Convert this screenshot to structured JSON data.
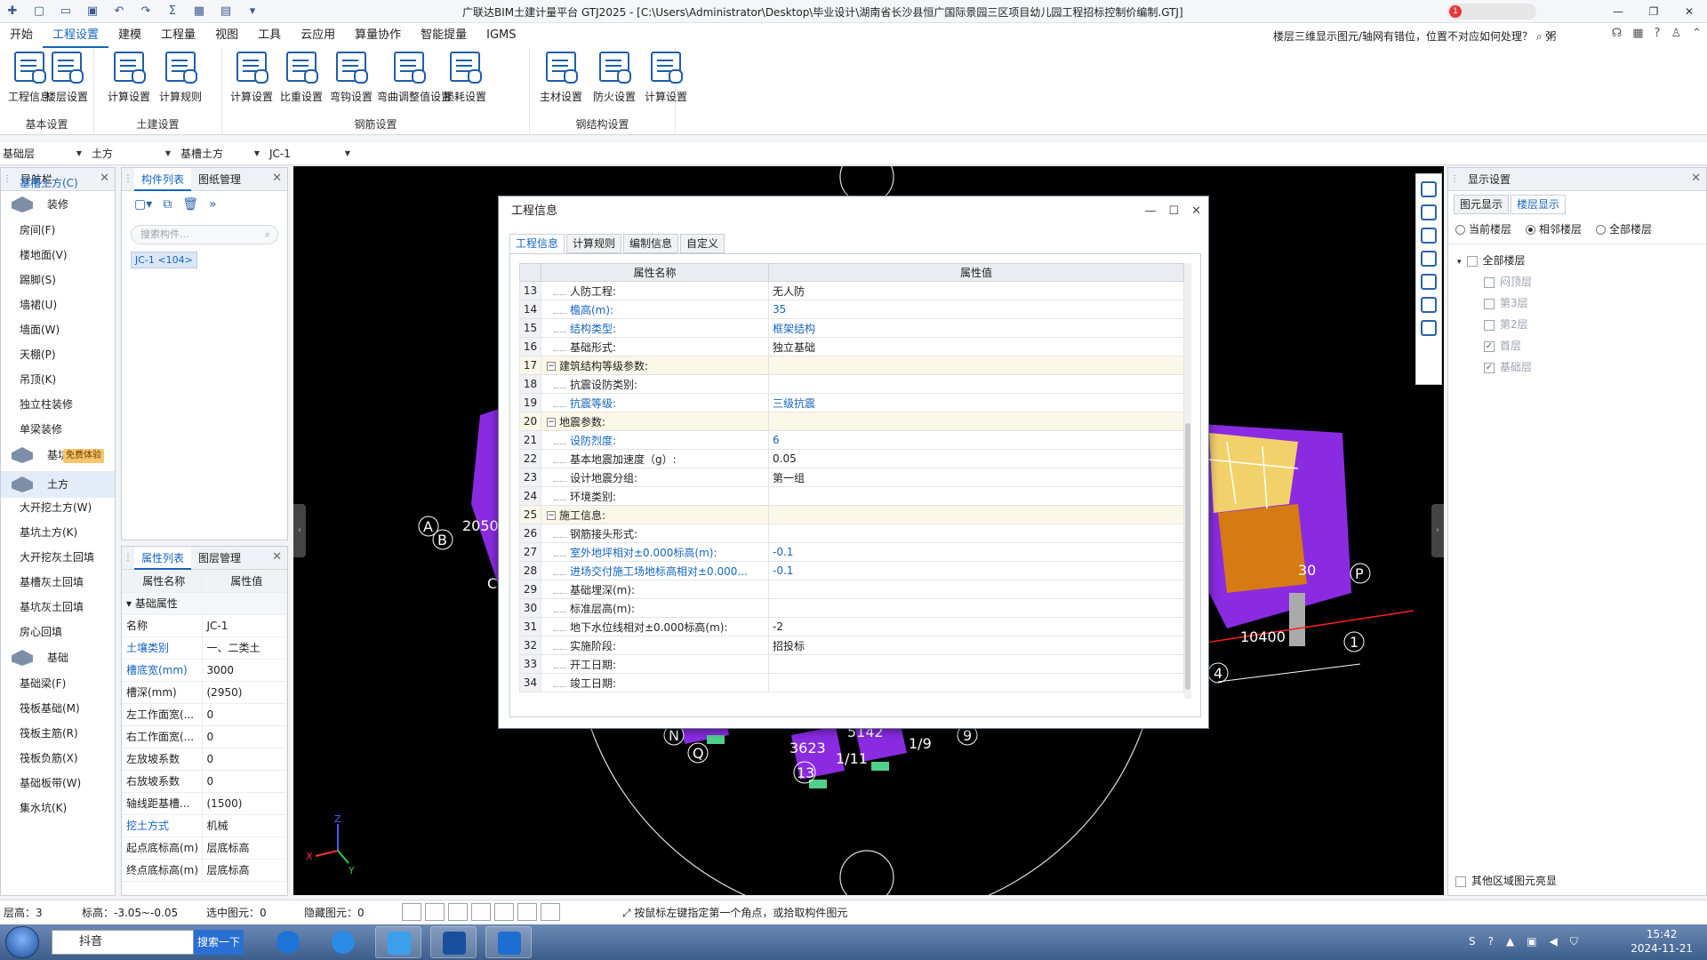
{
  "window": {
    "title": "广联达BIM土建计量平台 GTJ2025 - [C:\\Users\\Administrator\\Desktop\\毕业设计\\湖南省长沙县恒广国际景园三区项目幼儿园工程招标控制价编制.GTJ]",
    "badge_count": "1"
  },
  "menu": {
    "items": [
      "开始",
      "工程设置",
      "建模",
      "工程量",
      "视图",
      "工具",
      "云应用",
      "算量协作",
      "智能提量",
      "IGMS"
    ],
    "active": "工程设置",
    "help_question": "楼层三维显示图元/轴网有错位，位置不对应如何处理？",
    "help_suffix": "粥"
  },
  "ribbon": {
    "groups": [
      {
        "label": "基本设置",
        "buttons": [
          "工程信息",
          "楼层设置"
        ]
      },
      {
        "label": "土建设置",
        "buttons": [
          "计算设置",
          "计算规则"
        ]
      },
      {
        "label": "钢筋设置",
        "buttons": [
          "计算设置",
          "比重设置",
          "弯钩设置",
          "弯曲调整值设置",
          "损耗设置"
        ]
      },
      {
        "label": "钢结构设置",
        "buttons": [
          "主材设置",
          "防火设置",
          "计算设置"
        ]
      }
    ]
  },
  "selectors": {
    "floor": "基础层",
    "category": "土方",
    "type": "基槽土方",
    "component": "JC-1"
  },
  "nav": {
    "title": "导航栏",
    "tree": [
      {
        "kind": "cat",
        "label": "装修",
        "selected": false
      },
      {
        "kind": "item",
        "label": "房间(F)"
      },
      {
        "kind": "item",
        "label": "楼地面(V)"
      },
      {
        "kind": "item",
        "label": "踢脚(S)"
      },
      {
        "kind": "item",
        "label": "墙裙(U)"
      },
      {
        "kind": "item",
        "label": "墙面(W)"
      },
      {
        "kind": "item",
        "label": "天棚(P)"
      },
      {
        "kind": "item",
        "label": "吊顶(K)"
      },
      {
        "kind": "item",
        "label": "独立柱装修"
      },
      {
        "kind": "item",
        "label": "单梁装修"
      },
      {
        "kind": "cat",
        "label": "基坑支护",
        "badge": "免费体验",
        "selected": false
      },
      {
        "kind": "cat",
        "label": "土方",
        "selected": true
      },
      {
        "kind": "item",
        "label": "大开挖土方(W)"
      },
      {
        "kind": "item",
        "label": "基槽土方(C)",
        "selected": true
      },
      {
        "kind": "item",
        "label": "基坑土方(K)"
      },
      {
        "kind": "item",
        "label": "大开挖灰土回填"
      },
      {
        "kind": "item",
        "label": "基槽灰土回填"
      },
      {
        "kind": "item",
        "label": "基坑灰土回填"
      },
      {
        "kind": "item",
        "label": "房心回填"
      },
      {
        "kind": "cat",
        "label": "基础",
        "selected": false
      },
      {
        "kind": "item",
        "label": "基础梁(F)"
      },
      {
        "kind": "item",
        "label": "筏板基础(M)"
      },
      {
        "kind": "item",
        "label": "筏板主筋(R)"
      },
      {
        "kind": "item",
        "label": "筏板负筋(X)"
      },
      {
        "kind": "item",
        "label": "基础板带(W)"
      },
      {
        "kind": "item",
        "label": "集水坑(K)"
      }
    ]
  },
  "component_panel": {
    "tabs": [
      "构件列表",
      "图纸管理"
    ],
    "search_placeholder": "搜索构件...",
    "items": [
      "JC-1 <104>"
    ]
  },
  "property_panel": {
    "tabs": [
      "属性列表",
      "图层管理"
    ],
    "headers": [
      "属性名称",
      "属性值"
    ],
    "group": "基础属性",
    "rows": [
      {
        "name": "名称",
        "value": "JC-1",
        "blue": false
      },
      {
        "name": "土壤类别",
        "value": "一、二类土",
        "blue": true
      },
      {
        "name": "槽底宽(mm)",
        "value": "3000",
        "blue": true
      },
      {
        "name": "槽深(mm)",
        "value": "(2950)",
        "blue": false
      },
      {
        "name": "左工作面宽(...",
        "value": "0",
        "blue": false
      },
      {
        "name": "右工作面宽(...",
        "value": "0",
        "blue": false
      },
      {
        "name": "左放坡系数",
        "value": "0",
        "blue": false
      },
      {
        "name": "右放坡系数",
        "value": "0",
        "blue": false
      },
      {
        "name": "轴线距基槽...",
        "value": "(1500)",
        "blue": false
      },
      {
        "name": "挖土方式",
        "value": "机械",
        "blue": true
      },
      {
        "name": "起点底标高(m)",
        "value": "层底标高",
        "blue": false
      },
      {
        "name": "终点底标高(m)",
        "value": "层底标高",
        "blue": false
      }
    ]
  },
  "dialog": {
    "title": "工程信息",
    "tabs": [
      "工程信息",
      "计算规则",
      "编制信息",
      "自定义"
    ],
    "active_tab": "工程信息",
    "headers": [
      "属性名称",
      "属性值"
    ],
    "rows": [
      {
        "num": "13",
        "name": "人防工程:",
        "value": "无人防",
        "blue": false,
        "group": false
      },
      {
        "num": "14",
        "name": "檐高(m):",
        "value": "35",
        "blue": true,
        "group": false
      },
      {
        "num": "15",
        "name": "结构类型:",
        "value": "框架结构",
        "blue": true,
        "group": false
      },
      {
        "num": "16",
        "name": "基础形式:",
        "value": "独立基础",
        "blue": false,
        "group": false
      },
      {
        "num": "17",
        "name": "建筑结构等级参数:",
        "value": "",
        "blue": false,
        "group": true
      },
      {
        "num": "18",
        "name": "抗震设防类别:",
        "value": "",
        "blue": false,
        "group": false
      },
      {
        "num": "19",
        "name": "抗震等级:",
        "value": "三级抗震",
        "blue": true,
        "group": false
      },
      {
        "num": "20",
        "name": "地震参数:",
        "value": "",
        "blue": false,
        "group": true
      },
      {
        "num": "21",
        "name": "设防烈度:",
        "value": "6",
        "blue": true,
        "group": false
      },
      {
        "num": "22",
        "name": "基本地震加速度（g）:",
        "value": "0.05",
        "blue": false,
        "group": false
      },
      {
        "num": "23",
        "name": "设计地震分组:",
        "value": "第一组",
        "blue": false,
        "group": false
      },
      {
        "num": "24",
        "name": "环境类别:",
        "value": "",
        "blue": false,
        "group": false
      },
      {
        "num": "25",
        "name": "施工信息:",
        "value": "",
        "blue": false,
        "group": true
      },
      {
        "num": "26",
        "name": "钢筋接头形式:",
        "value": "",
        "blue": false,
        "group": false
      },
      {
        "num": "27",
        "name": "室外地坪相对±0.000标高(m):",
        "value": "-0.1",
        "blue": true,
        "group": false
      },
      {
        "num": "28",
        "name": "进场交付施工场地标高相对±0.000...",
        "value": "-0.1",
        "blue": true,
        "group": false
      },
      {
        "num": "29",
        "name": "基础埋深(m):",
        "value": "",
        "blue": false,
        "group": false
      },
      {
        "num": "30",
        "name": "标准层高(m):",
        "value": "",
        "blue": false,
        "group": false
      },
      {
        "num": "31",
        "name": "地下水位线相对±0.000标高(m):",
        "value": "-2",
        "blue": false,
        "group": false
      },
      {
        "num": "32",
        "name": "实施阶段:",
        "value": "招投标",
        "blue": false,
        "group": false
      },
      {
        "num": "33",
        "name": "开工日期:",
        "value": "",
        "blue": false,
        "group": false
      },
      {
        "num": "34",
        "name": "竣工日期:",
        "value": "",
        "blue": false,
        "group": false
      }
    ]
  },
  "display_panel": {
    "title": "显示设置",
    "tabs": [
      "图元显示",
      "楼层显示"
    ],
    "active_tab": "楼层显示",
    "radios": [
      {
        "label": "当前楼层",
        "on": false
      },
      {
        "label": "相邻楼层",
        "on": true
      },
      {
        "label": "全部楼层",
        "on": false
      }
    ],
    "tree_root": "全部楼层",
    "floors": [
      {
        "label": "闷顶层",
        "checked": false
      },
      {
        "label": "第3层",
        "checked": false
      },
      {
        "label": "第2层",
        "checked": false
      },
      {
        "label": "首层",
        "checked": true
      },
      {
        "label": "基础层",
        "checked": true
      }
    ],
    "footer": "其他区域图元亮显"
  },
  "viewport": {
    "axis_labels": [
      "A",
      "B",
      "P",
      "1",
      "4",
      "N",
      "Q",
      "13",
      "9",
      "1/11",
      "1/9",
      "C",
      "10400",
      "2050",
      "3623",
      "5142",
      "30"
    ],
    "axis_x": "X",
    "axis_y": "Y",
    "axis_z": "Z"
  },
  "statusbar": {
    "floor_height": "层高：3",
    "elevation": "标高：-3.05~-0.05",
    "selected": "选中图元：0",
    "hidden": "隐藏图元：0",
    "hint": "按鼠标左键指定第一个角点，或拾取构件图元"
  },
  "taskbar": {
    "search_value": "抖音",
    "search_button": "搜索一下",
    "time": "15:42",
    "date": "2024-11-21"
  }
}
